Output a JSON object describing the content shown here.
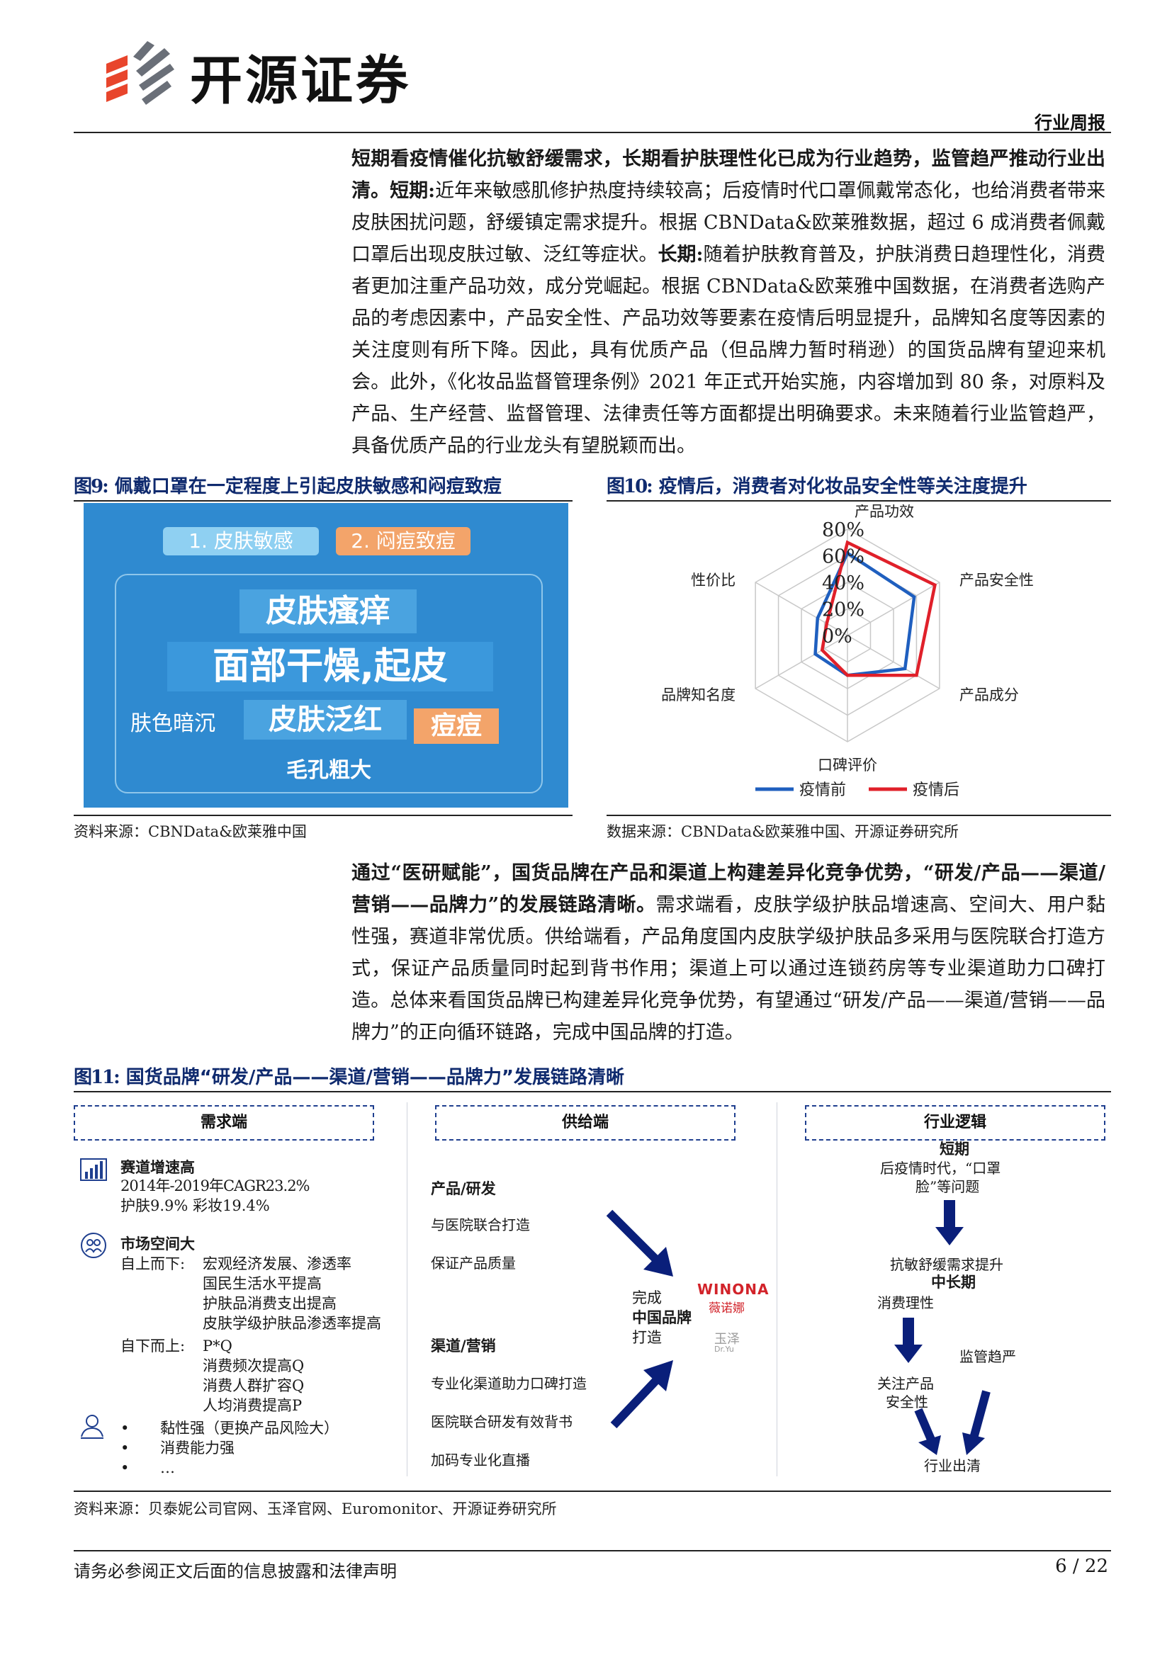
{
  "header": {
    "brand": "开源证券",
    "report_type": "行业周报"
  },
  "section1": {
    "lead_bold": "短期看疫情催化抗敏舒缓需求，长期看护肤理性化已成为行业趋势，监管趋严推动行业出清。",
    "short_label": "短期:",
    "short_text": "近年来敏感肌修护热度持续较高；后疫情时代口罩佩戴常态化，也给消费者带来皮肤困扰问题，舒缓镇定需求提升。根据 CBNData&欧莱雅数据，超过 6 成消费者佩戴口罩后出现皮肤过敏、泛红等症状。",
    "long_label": "长期:",
    "long_text": "随着护肤教育普及，护肤消费日趋理性化，消费者更加注重产品功效，成分党崛起。根据 CBNData&欧莱雅中国数据，在消费者选购产品的考虑因素中，产品安全性、产品功效等要素在疫情后明显提升，品牌知名度等因素的关注度则有所下降。因此，具有优质产品（但品牌力暂时稍逊）的国货品牌有望迎来机会。此外，《化妆品监督管理条例》2021 年正式开始实施，内容增加到 80 条，对原料及产品、生产经营、监督管理、法律责任等方面都提出明确要求。未来随着行业监管趋严，具备优质产品的行业龙头有望脱颖而出。"
  },
  "fig9": {
    "num": "图9:",
    "title": "佩戴口罩在一定程度上引起皮肤敏感和闷痘致痘",
    "tag1": "1. 皮肤敏感",
    "tag2": "2. 闷痘致痘",
    "items": [
      "皮肤瘙痒",
      "面部干燥,起皮",
      "肤色暗沉",
      "皮肤泛红",
      "痘痘",
      "毛孔粗大"
    ],
    "source": "资料来源：CBNData&欧莱雅中国"
  },
  "fig10": {
    "num": "图10:",
    "title": "疫情后，消费者对化妆品安全性等关注度提升",
    "source": "数据来源：CBNData&欧莱雅中国、开源证券研究所"
  },
  "chart_data": {
    "type": "radar",
    "categories": [
      "产品功效",
      "产品安全性",
      "产品成分",
      "口碑评价",
      "品牌知名度",
      "性价比"
    ],
    "radial_ticks": [
      "80%",
      "60%",
      "40%",
      "20%",
      "0%"
    ],
    "rlim": [
      0,
      0.8
    ],
    "series": [
      {
        "name": "疫情前",
        "color": "#1f5fbf",
        "values": [
          0.62,
          0.58,
          0.5,
          0.3,
          0.28,
          0.26
        ]
      },
      {
        "name": "疫情后",
        "color": "#e0202a",
        "values": [
          0.7,
          0.76,
          0.6,
          0.3,
          0.22,
          0.18
        ]
      }
    ],
    "legend": "bottom"
  },
  "section2": {
    "lead_bold": "通过“医研赋能”，国货品牌在产品和渠道上构建差异化竞争优势，“研发/产品——渠道/营销——品牌力”的发展链路清晰。",
    "text": "需求端看，皮肤学级护肤品增速高、空间大、用户黏性强，赛道非常优质。供给端看，产品角度国内皮肤学级护肤品多采用与医院联合打造方式，保证产品质量同时起到背书作用；渠道上可以通过连锁药房等专业渠道助力口碑打造。总体来看国货品牌已构建差异化竞争优势，有望通过“研发/产品——渠道/营销——品牌力”的正向循环链路，完成中国品牌的打造。"
  },
  "fig11": {
    "num": "图11:",
    "title": "国货品牌“研发/产品——渠道/营销——品牌力”发展链路清晰",
    "col1": {
      "header": "需求端",
      "g1_title": "赛道增速高",
      "g1_l1": "2014年-2019年CAGR23.2%",
      "g1_l2": "护肤9.9%  彩妆19.4%",
      "g2_title": "市场空间大",
      "g2_top_label": "自上而下:",
      "g2_top": [
        "宏观经济发展、渗透率",
        "国民生活水平提高",
        "护肤品消费支出提高",
        "皮肤学级护肤品渗透率提高"
      ],
      "g2_bottom_label": "自下而上:",
      "g2_bottom": [
        "P*Q",
        "消费频次提高Q",
        "消费人群扩容Q",
        "人均消费提高P"
      ],
      "g3": [
        "黏性强（更换产品风险大）",
        "消费能力强",
        "…"
      ]
    },
    "col2": {
      "header": "供给端",
      "product_title": "产品/研发",
      "product": [
        "与医院联合打造",
        "保证产品质量"
      ],
      "channel_title": "渠道/营销",
      "channel": [
        "专业化渠道助力口碑打造",
        "医院联合研发有效背书",
        "加码专业化直播"
      ],
      "center_l1": "完成",
      "center_l2": "中国品牌",
      "center_l3": "打造",
      "brand1_en": "WINONA",
      "brand1_cn": "薇诺娜",
      "brand2_cn": "玉泽",
      "brand2_en": "Dr.Yu"
    },
    "col3": {
      "header": "行业逻辑",
      "short_title": "短期",
      "short_l1": "后疫情时代，“口罩",
      "short_l2": "脸”等问题",
      "mid1": "抗敏舒缓需求提升",
      "mid_title": "中长期",
      "mid2": "消费理性",
      "reg": "监管趋严",
      "safe_l1": "关注产品",
      "safe_l2": "安全性",
      "end": "行业出清"
    },
    "source": "资料来源：贝泰妮公司官网、玉泽官网、Euromonitor、开源证券研究所"
  },
  "footer": {
    "disclaimer": "请务必参阅正文后面的信息披露和法律声明",
    "page": "6 / 22"
  },
  "colors": {
    "navy": "#0f2a6e",
    "arrow": "#0a1f7a",
    "red": "#e0202a",
    "blue": "#1f5fbf"
  }
}
